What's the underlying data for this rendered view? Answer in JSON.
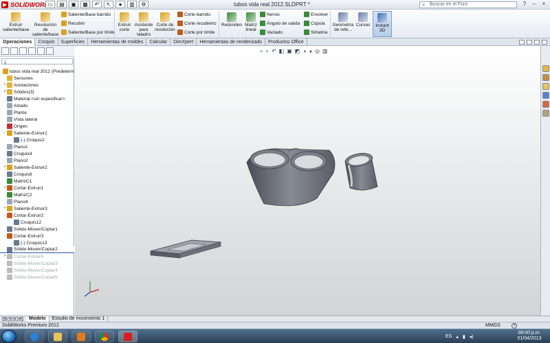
{
  "titlebar": {
    "app_logo_text": "SOLIDWORKS",
    "document_title": "tubos vida real 2012.SLDPRT *",
    "search_placeholder": "Buscar en el Foro",
    "window_buttons": [
      "?",
      "–",
      "×"
    ]
  },
  "ribbon": {
    "buttons": [
      {
        "id": "extruir",
        "label": "Extruir saliente/base",
        "color": "#d9a21b"
      },
      {
        "id": "revolucion",
        "label": "Revolución de saliente/base",
        "color": "#d9a21b"
      },
      {
        "id": "extruir_corte",
        "label": "Extruir corte",
        "color": "#d9a21b"
      },
      {
        "id": "asistente",
        "label": "Asistente para taladro",
        "color": "#d9a21b"
      },
      {
        "id": "corte_rev",
        "label": "Corte de revolución",
        "color": "#d9a21b"
      },
      {
        "id": "redondeo",
        "label": "Redondeo",
        "color": "#3b8a3b"
      },
      {
        "id": "matriz",
        "label": "Matriz lineal",
        "color": "#3b8a3b"
      },
      {
        "id": "geometria",
        "label": "Geometría de refe...",
        "color": "#6b7fa8"
      },
      {
        "id": "curvas",
        "label": "Curvas",
        "color": "#6b7fa8"
      },
      {
        "id": "instant",
        "label": "Instant 3D",
        "color": "#3a6fb5"
      }
    ],
    "small_buttons": [
      {
        "id": "saliente_barrido",
        "label": "Saliente/Base barrido",
        "color": "#d9a21b"
      },
      {
        "id": "recubrir",
        "label": "Recubrir",
        "color": "#d9a21b"
      },
      {
        "id": "saliente_limite",
        "label": "Saliente/Base por límite",
        "color": "#d9a21b"
      },
      {
        "id": "corte_barrido",
        "label": "Corte barrido",
        "color": "#c25a1c"
      },
      {
        "id": "corte_recubierto",
        "label": "Corte recubierto",
        "color": "#c25a1c"
      },
      {
        "id": "corte_limite",
        "label": "Corte por límite",
        "color": "#c25a1c"
      },
      {
        "id": "nervio",
        "label": "Nervio",
        "color": "#3b8a3b"
      },
      {
        "id": "angulo",
        "label": "Ángulo de salida",
        "color": "#3b8a3b"
      },
      {
        "id": "vaciado",
        "label": "Vaciado",
        "color": "#3b8a3b"
      },
      {
        "id": "envolver",
        "label": "Envolver",
        "color": "#3b8a3b"
      },
      {
        "id": "cupula",
        "label": "Cúpula",
        "color": "#3b8a3b"
      },
      {
        "id": "simetria",
        "label": "Simetría",
        "color": "#3b8a3b"
      }
    ]
  },
  "tabs": [
    "Operaciones",
    "Croquis",
    "Superficies",
    "Herramientas de moldes",
    "Calcular",
    "DimXpert",
    "Herramientas de renderizado",
    "Productos Office"
  ],
  "tree": [
    {
      "label": "tubos vida real 2012  (Predeterm",
      "exp": "",
      "icon": "#d9a21b",
      "state": "root"
    },
    {
      "label": "Sensores",
      "exp": "",
      "icon": "#e0b43a",
      "state": ""
    },
    {
      "label": "Anotaciones",
      "exp": "+",
      "icon": "#e0b43a",
      "state": ""
    },
    {
      "label": "Sólidos(3)",
      "exp": "+",
      "icon": "#e0b43a",
      "state": ""
    },
    {
      "label": "Material <sin especificar>",
      "exp": "",
      "icon": "#6a7b8c",
      "state": ""
    },
    {
      "label": "Alzado",
      "exp": "",
      "icon": "#9aa7b5",
      "state": ""
    },
    {
      "label": "Planta",
      "exp": "",
      "icon": "#9aa7b5",
      "state": ""
    },
    {
      "label": "Vista lateral",
      "exp": "",
      "icon": "#9aa7b5",
      "state": ""
    },
    {
      "label": "Origen",
      "exp": "",
      "icon": "#c23030",
      "state": ""
    },
    {
      "label": "Saliente-Extruir1",
      "exp": "-",
      "icon": "#d9a21b",
      "state": ""
    },
    {
      "label": "(-) Croquis2",
      "exp": "",
      "icon": "#6a7b8c",
      "state": "child"
    },
    {
      "label": "Plano1",
      "exp": "",
      "icon": "#9aa7b5",
      "state": ""
    },
    {
      "label": "Croquis4",
      "exp": "",
      "icon": "#6a7b8c",
      "state": ""
    },
    {
      "label": "Plano2",
      "exp": "",
      "icon": "#9aa7b5",
      "state": ""
    },
    {
      "label": "Saliente-Extruir2",
      "exp": "+",
      "icon": "#d9a21b",
      "state": ""
    },
    {
      "label": "Croquis8",
      "exp": "",
      "icon": "#6a7b8c",
      "state": ""
    },
    {
      "label": "MatrizC1",
      "exp": "",
      "icon": "#3b8a3b",
      "state": ""
    },
    {
      "label": "Cortar-Extruir1",
      "exp": "+",
      "icon": "#c25a1c",
      "state": ""
    },
    {
      "label": "MatrizC2",
      "exp": "",
      "icon": "#3b8a3b",
      "state": ""
    },
    {
      "label": "Plano4",
      "exp": "",
      "icon": "#9aa7b5",
      "state": ""
    },
    {
      "label": "Saliente-Extruir3",
      "exp": "+",
      "icon": "#d9a21b",
      "state": ""
    },
    {
      "label": "Cortar-Extruir2",
      "exp": "-",
      "icon": "#c25a1c",
      "state": ""
    },
    {
      "label": "Croquis12",
      "exp": "",
      "icon": "#6a7b8c",
      "state": "child"
    },
    {
      "label": "Sólido-Mover/Copiar1",
      "exp": "",
      "icon": "#6a7b8c",
      "state": ""
    },
    {
      "label": "Cortar-Extruir3",
      "exp": "-",
      "icon": "#c25a1c",
      "state": ""
    },
    {
      "label": "(-) Croquis13",
      "exp": "",
      "icon": "#6a7b8c",
      "state": "child"
    },
    {
      "label": "Sólido-Mover/Copiar2",
      "exp": "",
      "icon": "#6a7b8c",
      "state": "sel"
    },
    {
      "label": "Cortar-Extruir5",
      "exp": "+",
      "icon": "#bbbbbb",
      "state": "sup"
    },
    {
      "label": "Sólido-Mover/Copiar3",
      "exp": "",
      "icon": "#bbbbbb",
      "state": "sup"
    },
    {
      "label": "Sólido-Mover/Copiar4",
      "exp": "",
      "icon": "#bbbbbb",
      "state": "sup"
    },
    {
      "label": "Sólido-Mover/Copiar5",
      "exp": "",
      "icon": "#bbbbbb",
      "state": "sup"
    }
  ],
  "bottom_tabs": [
    "Modelo",
    "Estudio de movimiento 1"
  ],
  "status": {
    "left": "SolidWorks Premium 2012",
    "units": "MMGS",
    "help": "?"
  },
  "taskbar": {
    "apps": [
      {
        "name": "ie",
        "color": "#2a7fd6"
      },
      {
        "name": "explorer",
        "color": "#e8c35a"
      },
      {
        "name": "media",
        "color": "#e07a1e"
      },
      {
        "name": "chrome",
        "color": "#4caf50"
      },
      {
        "name": "solidworks",
        "color": "#d42020"
      }
    ],
    "language": "ES",
    "time": "08:00 p.m.",
    "date": "01/04/2013"
  },
  "colors": {
    "model_gray": "#70737b",
    "model_dark": "#4a4d55",
    "model_light": "#a2a6ae",
    "accent": "#2a4fb5"
  }
}
